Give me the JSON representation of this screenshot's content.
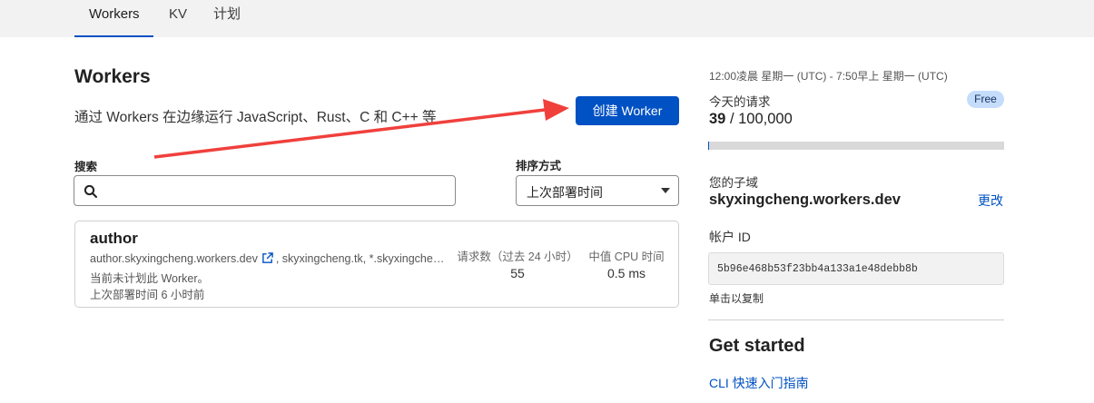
{
  "nav": {
    "tabs": [
      {
        "label": "Workers",
        "active": true
      },
      {
        "label": "KV",
        "active": false
      },
      {
        "label": "计划",
        "active": false
      }
    ]
  },
  "main": {
    "title": "Workers",
    "description": "通过 Workers 在边缘运行 JavaScript、Rust、C 和 C++ 等",
    "create_button": "创建 Worker",
    "search": {
      "label": "搜索",
      "value": "",
      "placeholder": ""
    },
    "sort": {
      "label": "排序方式",
      "value": "上次部署时间"
    },
    "workers": [
      {
        "name": "author",
        "routes_primary": "author.skyxingcheng.workers.dev",
        "routes_more": ", skyxingcheng.tk, *.skyxingche…",
        "note": "当前未计划此 Worker。",
        "last_deploy": "上次部署时间 6 小时前",
        "requests_label": "请求数（过去 24 小时）",
        "requests": "55",
        "cpu_label": "中值 CPU 时间",
        "cpu": "0.5 ms"
      }
    ]
  },
  "sidebar": {
    "time_range": "12:00凌晨 星期一 (UTC) - 7:50早上 星期一 (UTC)",
    "requests_label": "今天的请求",
    "plan_badge": "Free",
    "requests_used": "39",
    "requests_sep": " / ",
    "requests_limit": "100,000",
    "usage_fraction": 0.00039,
    "subdomain_label": "您的子域",
    "subdomain": "skyxingcheng.workers.dev",
    "change_link": "更改",
    "account_id_label": "帐户 ID",
    "account_id": "5b96e468b53f23bb4a133a1e48debb8b",
    "copy_hint": "单击以复制",
    "get_started": "Get started",
    "cli_link": "CLI 快速入门指南"
  },
  "colors": {
    "accent": "#0051c3",
    "annotation_arrow": "#f0403c",
    "badge_bg": "#c5dcfb"
  }
}
